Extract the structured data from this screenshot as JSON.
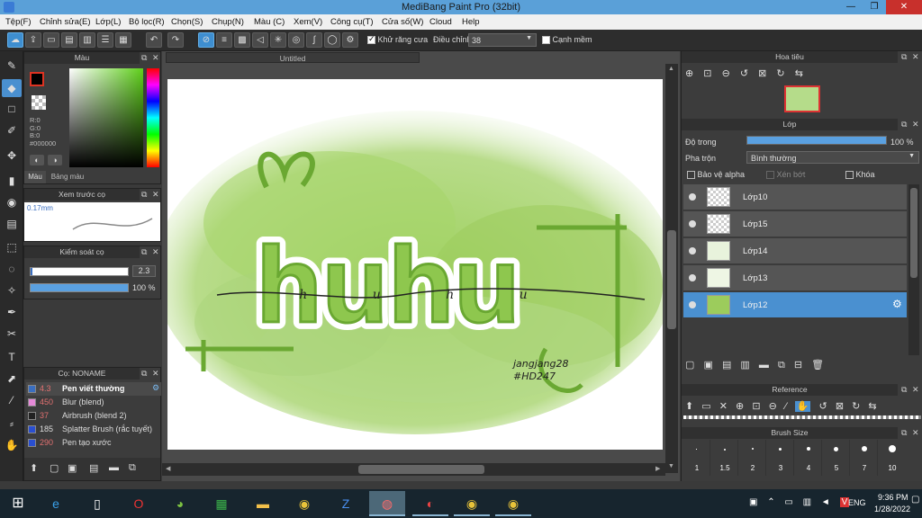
{
  "window": {
    "title": "MediBang Paint Pro (32bit)",
    "minimize": "—",
    "maximize": "❐",
    "close": "✕"
  },
  "menu": [
    "Tệp(F)",
    "Chỉnh sửa(E)",
    "Lớp(L)",
    "Bộ lọc(R)",
    "Chọn(S)",
    "Chụp(N)",
    "Màu (C)",
    "Xem(V)",
    "Công cụ(T)",
    "Cửa số(W)",
    "Cloud",
    "Help"
  ],
  "toolbar": {
    "antialias_label": "Khử răng cưa",
    "correction_label": "Điều chỉnh",
    "correction_value": "38",
    "sharp_edge_label": "Cạnh mềm"
  },
  "color_panel": {
    "title": "Màu",
    "r": "R:0",
    "g": "G:0",
    "b": "B:0",
    "hex": "#000000",
    "tab_color": "Màu",
    "tab_palette": "Bảng màu",
    "fg": "#000000",
    "bg": "#ffffff"
  },
  "brush_preview": {
    "title": "Xem trước cọ",
    "size": "0.17mm"
  },
  "brush_control": {
    "title": "Kiểm soát cọ",
    "size_value": "2.3",
    "opacity_value": "100 %"
  },
  "brush_list": {
    "title": "Cọ: NONAME",
    "items": [
      {
        "size": "4.3",
        "name": "Pen viết thường",
        "color": "#3a6ec0",
        "selected": true
      },
      {
        "size": "450",
        "name": "Blur (blend)",
        "color": "#e58ad8"
      },
      {
        "size": "37",
        "name": "Airbrush (blend 2)",
        "color": "#222222"
      },
      {
        "size": "185",
        "name": "Splatter Brush (rắc tuyết)",
        "color": "#2a4fd0"
      },
      {
        "size": "290",
        "name": "Pen tạo xước",
        "color": "#2a4fd0"
      }
    ]
  },
  "document": {
    "tab": "Untitled"
  },
  "artwork": {
    "main": "huhu",
    "script": "h u h u",
    "signature_1": "jangjang28",
    "signature_2": "#HD247"
  },
  "navigator": {
    "title": "Hoa tiêu"
  },
  "layers": {
    "title": "Lớp",
    "opacity_label": "Độ trong",
    "opacity_value": "100 %",
    "opacity_fraction": 1.0,
    "blend_label": "Pha trộn",
    "blend_value": "Bình thường",
    "protect_alpha": "Bảo vệ alpha",
    "clipping": "Xén bớt",
    "lock": "Khóa",
    "items": [
      {
        "name": "Lớp10",
        "selected": false
      },
      {
        "name": "Lớp15",
        "selected": false
      },
      {
        "name": "Lớp14",
        "selected": false
      },
      {
        "name": "Lớp13",
        "selected": false
      },
      {
        "name": "Lớp12",
        "selected": true
      }
    ]
  },
  "reference": {
    "title": "Reference"
  },
  "brush_size": {
    "title": "Brush Size",
    "values": [
      "1",
      "1.5",
      "2",
      "3",
      "4",
      "5",
      "7",
      "10"
    ]
  },
  "taskbar": {
    "time": "9:36 PM",
    "date": "1/28/2022",
    "lang": "ENG"
  }
}
